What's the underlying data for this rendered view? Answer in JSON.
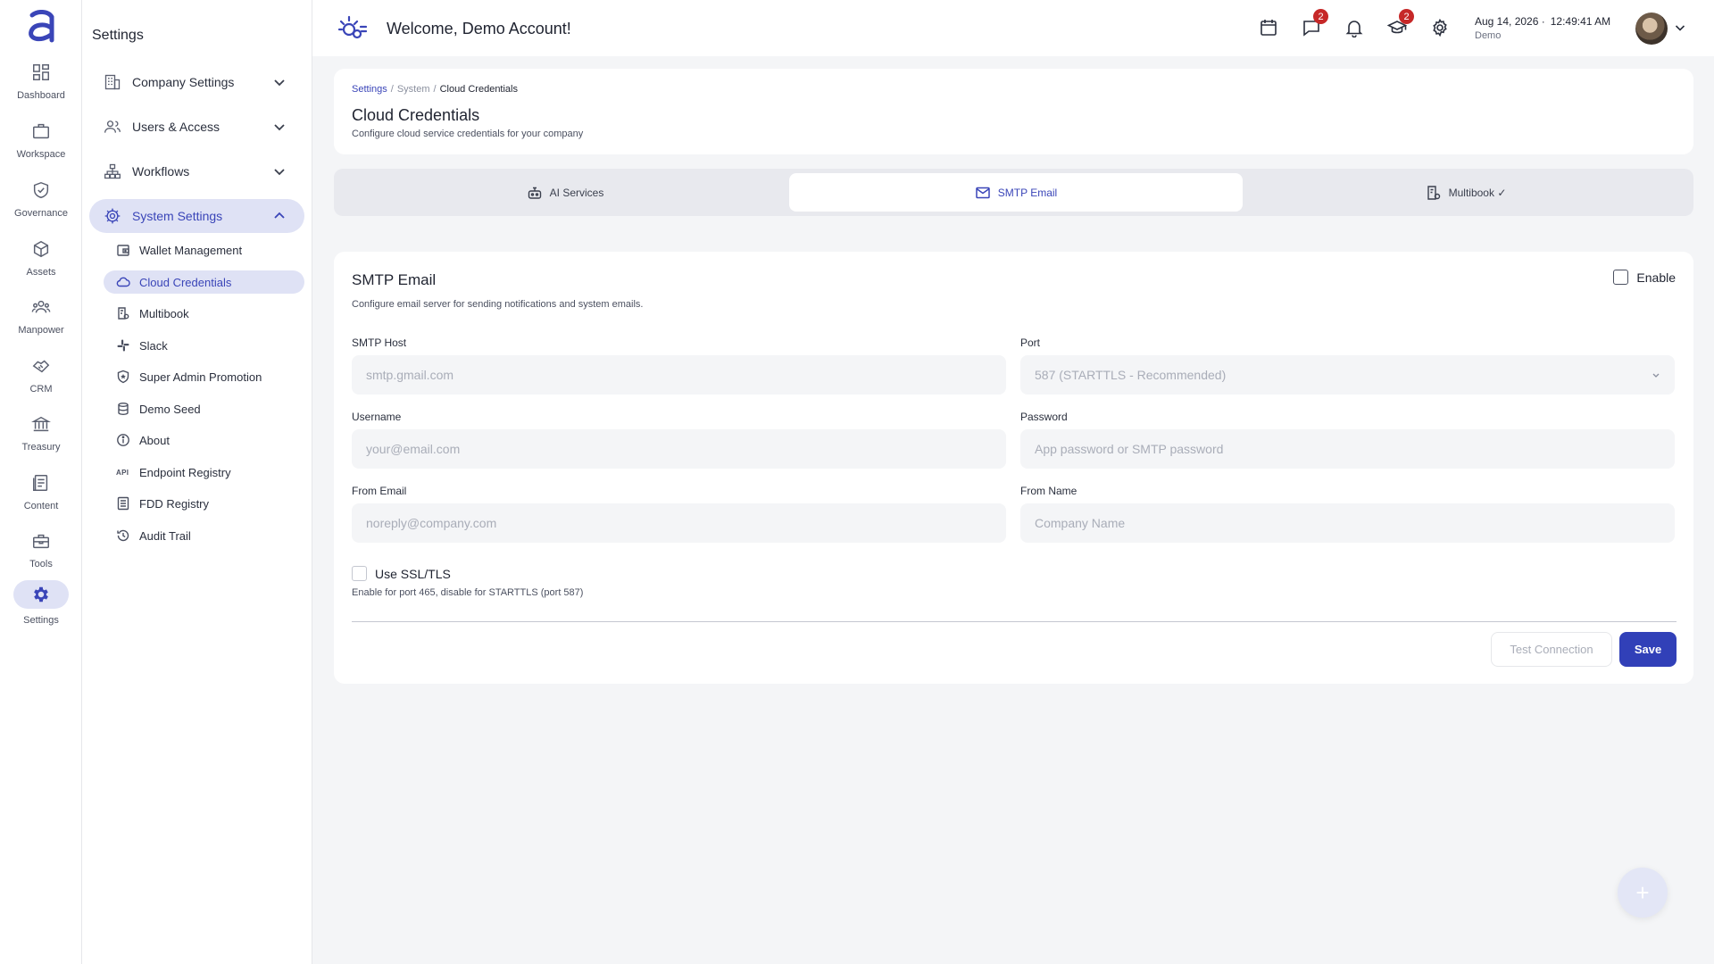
{
  "rail": {
    "items": [
      {
        "label": "Dashboard",
        "icon": "dashboard-icon"
      },
      {
        "label": "Workspace",
        "icon": "briefcase-icon"
      },
      {
        "label": "Governance",
        "icon": "shield-check-icon"
      },
      {
        "label": "Assets",
        "icon": "cube-icon"
      },
      {
        "label": "Manpower",
        "icon": "people-icon"
      },
      {
        "label": "CRM",
        "icon": "handshake-icon"
      },
      {
        "label": "Treasury",
        "icon": "bank-icon"
      },
      {
        "label": "Content",
        "icon": "document-icon"
      },
      {
        "label": "Tools",
        "icon": "toolbox-icon"
      },
      {
        "label": "Settings",
        "icon": "gear-icon"
      }
    ],
    "active": "Settings"
  },
  "sidebar": {
    "title": "Settings",
    "groups": [
      {
        "label": "Company Settings",
        "icon": "building-icon"
      },
      {
        "label": "Users & Access",
        "icon": "users-icon"
      },
      {
        "label": "Workflows",
        "icon": "hierarchy-icon"
      },
      {
        "label": "System Settings",
        "icon": "gear-icon"
      }
    ],
    "system_items": [
      {
        "label": "Wallet Management",
        "icon": "wallet-icon"
      },
      {
        "label": "Cloud Credentials",
        "icon": "cloud-icon"
      },
      {
        "label": "Multibook",
        "icon": "multibook-icon"
      },
      {
        "label": "Slack",
        "icon": "slack-icon"
      },
      {
        "label": "Super Admin Promotion",
        "icon": "shield-star-icon"
      },
      {
        "label": "Demo Seed",
        "icon": "database-icon"
      },
      {
        "label": "About",
        "icon": "info-icon"
      },
      {
        "label": "Endpoint Registry",
        "icon": "api-icon",
        "tag": "API"
      },
      {
        "label": "FDD Registry",
        "icon": "list-icon"
      },
      {
        "label": "Audit Trail",
        "icon": "history-icon"
      }
    ],
    "active_item": "Cloud Credentials"
  },
  "header": {
    "welcome": "Welcome, Demo Account!",
    "messages_badge": "2",
    "learning_badge": "2",
    "date": "Aug 14, 2026 ·",
    "time": "12:49:41 AM",
    "user": "Demo"
  },
  "page": {
    "breadcrumb": [
      "Settings",
      "System",
      "Cloud Credentials"
    ],
    "title": "Cloud Credentials",
    "description": "Configure cloud service credentials for your company"
  },
  "tabs": [
    {
      "label": "AI Services",
      "icon": "robot-icon"
    },
    {
      "label": "SMTP Email",
      "icon": "mail-icon"
    },
    {
      "label": "Multibook ✓",
      "icon": "multibook-icon"
    }
  ],
  "active_tab": "SMTP Email",
  "smtp": {
    "title": "SMTP Email",
    "description": "Configure email server for sending notifications and system emails.",
    "enable_label": "Enable",
    "host_label": "SMTP Host",
    "host_placeholder": "smtp.gmail.com",
    "port_label": "Port",
    "port_value": "587 (STARTTLS - Recommended)",
    "username_label": "Username",
    "username_placeholder": "your@email.com",
    "password_label": "Password",
    "password_placeholder": "App password or SMTP password",
    "from_email_label": "From Email",
    "from_email_placeholder": "noreply@company.com",
    "from_name_label": "From Name",
    "from_name_placeholder": "Company Name",
    "ssl_label": "Use SSL/TLS",
    "ssl_hint": "Enable for port 465, disable for STARTTLS (port 587)",
    "test_button": "Test Connection",
    "save_button": "Save"
  },
  "fab_symbol": "+",
  "colors": {
    "accent": "#3a45b8",
    "accent_bg": "#dfe2f5",
    "badge": "#c62828",
    "save": "#3140b8"
  }
}
